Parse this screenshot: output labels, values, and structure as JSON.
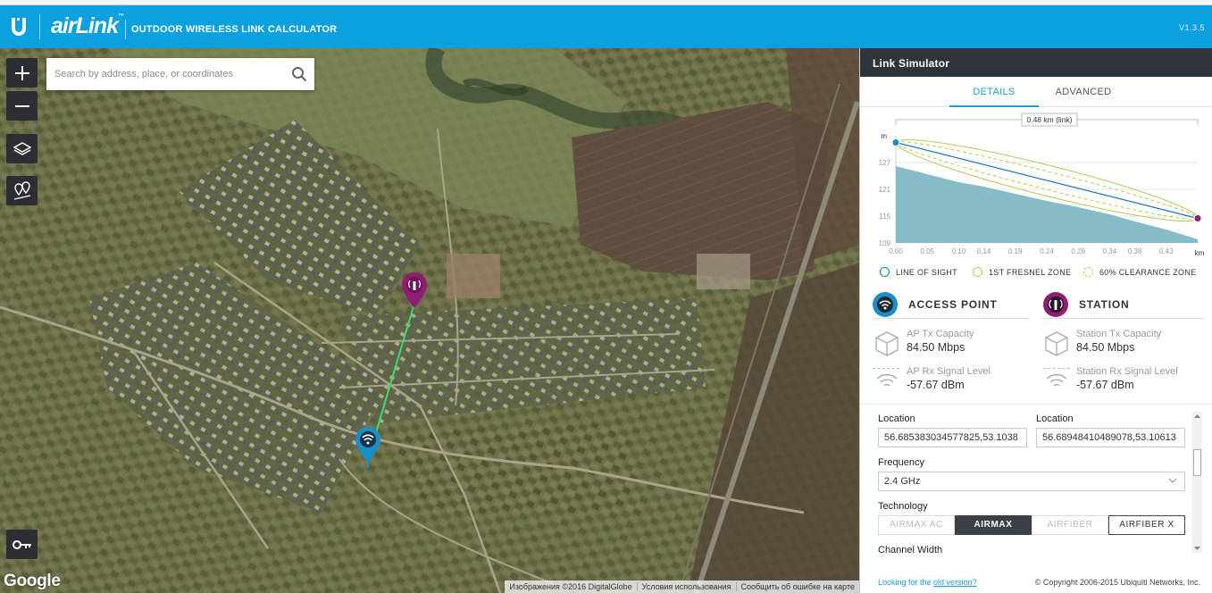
{
  "header": {
    "brand": "airLink",
    "trademark": "™",
    "subtitle": "OUTDOOR WIRELESS LINK CALCULATOR",
    "version": "V1.3.5"
  },
  "map": {
    "search_placeholder": "Search by address, place, or coordinates",
    "google_label": "Google",
    "attribution": [
      "Изображения ©2016 DigitalGlobe",
      "Условия использования",
      "Сообщить об ошибке на карте"
    ],
    "buttons": [
      "zoom-in",
      "zoom-out",
      "layers",
      "markers",
      "key"
    ]
  },
  "panel": {
    "title": "Link Simulator",
    "tabs": {
      "details": "DETAILS",
      "advanced": "ADVANCED"
    },
    "chart_data": {
      "type": "area",
      "title": "",
      "distance_label": "0.48 km (link)",
      "xlabel": "km",
      "ylabel": "m",
      "x_ticks": [
        "0.00",
        "0.05",
        "0.10",
        "0.14",
        "0.19",
        "0.24",
        "0.29",
        "0.34",
        "0.38",
        "0.43"
      ],
      "y_ticks": [
        "127",
        "121",
        "115",
        "109"
      ],
      "ylim": [
        109,
        133
      ],
      "xlim": [
        0,
        0.48
      ],
      "terrain": {
        "x": [
          0,
          0.05,
          0.1,
          0.14,
          0.19,
          0.24,
          0.29,
          0.34,
          0.38,
          0.43,
          0.48
        ],
        "y": [
          126.2,
          124.4,
          122.6,
          121.6,
          120.0,
          118.4,
          117.0,
          115.4,
          113.8,
          112.0,
          109.8
        ]
      },
      "line_of_sight": {
        "x": [
          0,
          0.48
        ],
        "y": [
          131.5,
          114.5
        ]
      },
      "colors": {
        "terrain": "#79b5c1",
        "los": "#1f72c8",
        "fresnel": "#b7c95a",
        "ap": "#1b8fc5",
        "station": "#8e1e73"
      },
      "legend": [
        "LINE OF SIGHT",
        "1ST FRESNEL ZONE",
        "60% CLEARANCE ZONE"
      ],
      "legend_placement": "bottom"
    },
    "access_point": {
      "title": "ACCESS POINT",
      "tx_label": "AP Tx Capacity",
      "tx_value": "84.50 Mbps",
      "rx_label": "AP Rx Signal Level",
      "rx_value": "-57.67 dBm"
    },
    "station": {
      "title": "STATION",
      "tx_label": "Station Tx Capacity",
      "tx_value": "84.50 Mbps",
      "rx_label": "Station Rx Signal Level",
      "rx_value": "-57.67 dBm"
    },
    "form": {
      "location_label_ap": "Location",
      "location_value_ap": "56.685383034577825,53.1038",
      "location_label_sta": "Location",
      "location_value_sta": "56.68948410489078,53.10613",
      "frequency_label": "Frequency",
      "frequency_value": "2.4 GHz",
      "technology_label": "Technology",
      "technology_options": [
        "AIRMAX AC",
        "AIRMAX",
        "AIRFIBER",
        "AIRFIBER X"
      ],
      "channel_width_label": "Channel Width"
    },
    "footer": {
      "old_prefix": "Looking for the ",
      "old_link": "old version?",
      "copyright": "© Copyright 2006-2015 Ubiquiti Networks, Inc."
    }
  }
}
